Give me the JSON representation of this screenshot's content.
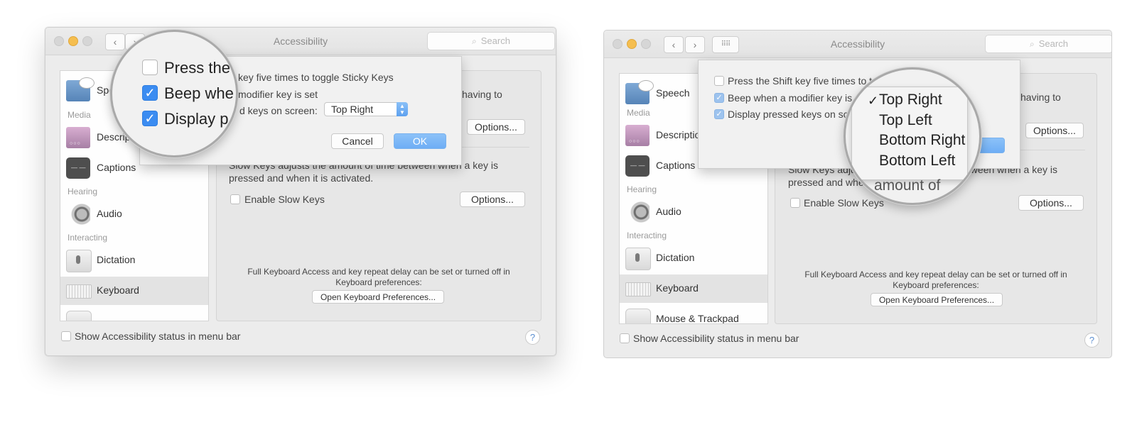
{
  "left": {
    "title": "Accessibility",
    "search_placeholder": "Search",
    "sidebar": {
      "speech": "Speech",
      "head_media": "Media",
      "descriptions": "Descriptions",
      "captions": "Captions",
      "head_hearing": "Hearing",
      "audio": "Audio",
      "head_interacting": "Interacting",
      "dictation": "Dictation",
      "keyboard": "Keyboard"
    },
    "panel": {
      "having_to": "having to",
      "options1": "Options...",
      "slow_keys_desc_1": "Slow Keys adjusts the amount of time between when a key is",
      "slow_keys_desc_2": "pressed and when it is activated.",
      "enable_slow_keys": "Enable Slow Keys",
      "options2": "Options...",
      "footer_1": "Full Keyboard Access and key repeat delay can be set or turned off in",
      "footer_2": "Keyboard preferences:",
      "open_keyboard_prefs": "Open Keyboard Preferences..."
    },
    "sheet": {
      "line1": "key five times to toggle Sticky Keys",
      "line2": "modifier key is set",
      "line3": "d keys on screen:",
      "popup_value": "Top Right",
      "cancel": "Cancel",
      "ok": "OK"
    },
    "magnifier": {
      "line1": "Press the",
      "line2": "Beep whe",
      "line3": "Display p"
    },
    "show_status": "Show Accessibility status in menu bar",
    "help": "?"
  },
  "right": {
    "title": "Accessibility",
    "search_placeholder": "Search",
    "sidebar": {
      "speech": "Speech",
      "head_media": "Media",
      "descriptions": "Descriptions",
      "captions": "Captions",
      "head_hearing": "Hearing",
      "audio": "Audio",
      "head_interacting": "Interacting",
      "dictation": "Dictation",
      "keyboard": "Keyboard",
      "mouse_trackpad": "Mouse & Trackpad"
    },
    "panel": {
      "having_to": "having to",
      "options1": "Options...",
      "slow_keys_desc_1": "Slow Keys adjusts the amount of time between when a key is",
      "slow_keys_desc_2": "pressed and when it is activated.",
      "enable_slow_keys": "Enable Slow Keys",
      "options2": "Options...",
      "footer_1": "Full Keyboard Access and key repeat delay can be set or turned off in",
      "footer_2": "Keyboard preferences:",
      "open_keyboard_prefs": "Open Keyboard Preferences..."
    },
    "sheet": {
      "line1": "Press the Shift key five times to toggle Sticky Keys",
      "line2": "Beep when a modifier key is set",
      "line3": "Display pressed keys on screen:"
    },
    "menu": {
      "items": [
        "Top Right",
        "Top Left",
        "Bottom Right",
        "Bottom Left"
      ],
      "selected": "Top Right",
      "behind_text": "amount of"
    },
    "show_status": "Show Accessibility status in menu bar",
    "help": "?"
  },
  "colors": {
    "accent_blue": "#3b8cf1",
    "ok_button_blue": "#7ab6f5",
    "window_bg": "#ececec"
  }
}
